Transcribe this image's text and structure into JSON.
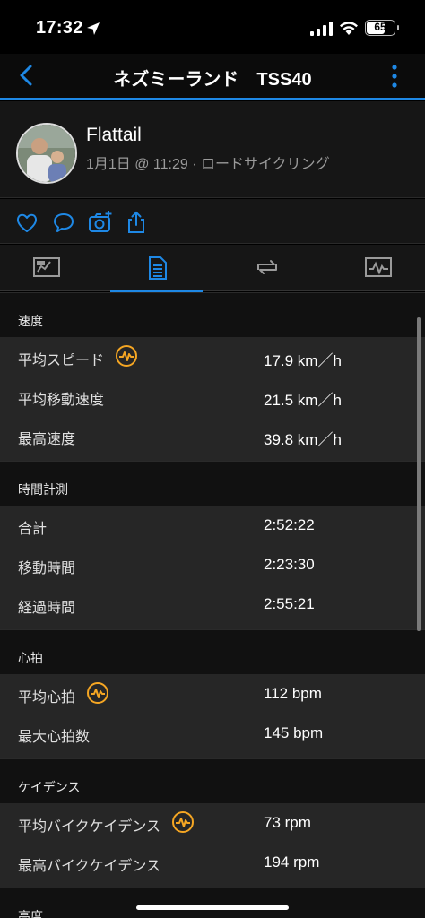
{
  "status": {
    "time": "17:32",
    "battery": "65",
    "battery_level": 0.65
  },
  "nav": {
    "title": "ネズミーランド　TSS40"
  },
  "profile": {
    "name": "Flattail",
    "subtitle": "1月1日 @ 11:29 · ロードサイクリング"
  },
  "icons": {
    "back": "chevron-left-icon",
    "more": "more-vertical-icon",
    "like": "heart-icon",
    "comment": "comment-icon",
    "photo": "add-photo-icon",
    "share": "share-icon",
    "tab1": "map-icon",
    "tab2": "stats-list-icon",
    "tab3": "laps-icon",
    "tab4": "chart-icon",
    "badge": "heart-rate-badge-icon"
  },
  "colors": {
    "accent": "#1e88e5",
    "badge": "#f5a623"
  },
  "sections": [
    {
      "title": "速度",
      "rows": [
        {
          "label": "平均スピード",
          "value": "17.9 km／h",
          "badge": true
        },
        {
          "label": "平均移動速度",
          "value": "21.5 km／h",
          "badge": false
        },
        {
          "label": "最高速度",
          "value": "39.8 km／h",
          "badge": false
        }
      ]
    },
    {
      "title": "時間計測",
      "rows": [
        {
          "label": "合計",
          "value": "2:52:22",
          "badge": false
        },
        {
          "label": "移動時間",
          "value": "2:23:30",
          "badge": false
        },
        {
          "label": "経過時間",
          "value": "2:55:21",
          "badge": false
        }
      ]
    },
    {
      "title": "心拍",
      "rows": [
        {
          "label": "平均心拍",
          "value": "112 bpm",
          "badge": true
        },
        {
          "label": "最大心拍数",
          "value": "145 bpm",
          "badge": false
        }
      ]
    },
    {
      "title": "ケイデンス",
      "rows": [
        {
          "label": "平均バイクケイデンス",
          "value": "73 rpm",
          "badge": true
        },
        {
          "label": "最高バイクケイデンス",
          "value": "194 rpm",
          "badge": false
        }
      ]
    },
    {
      "title": "高度",
      "rows": []
    }
  ]
}
